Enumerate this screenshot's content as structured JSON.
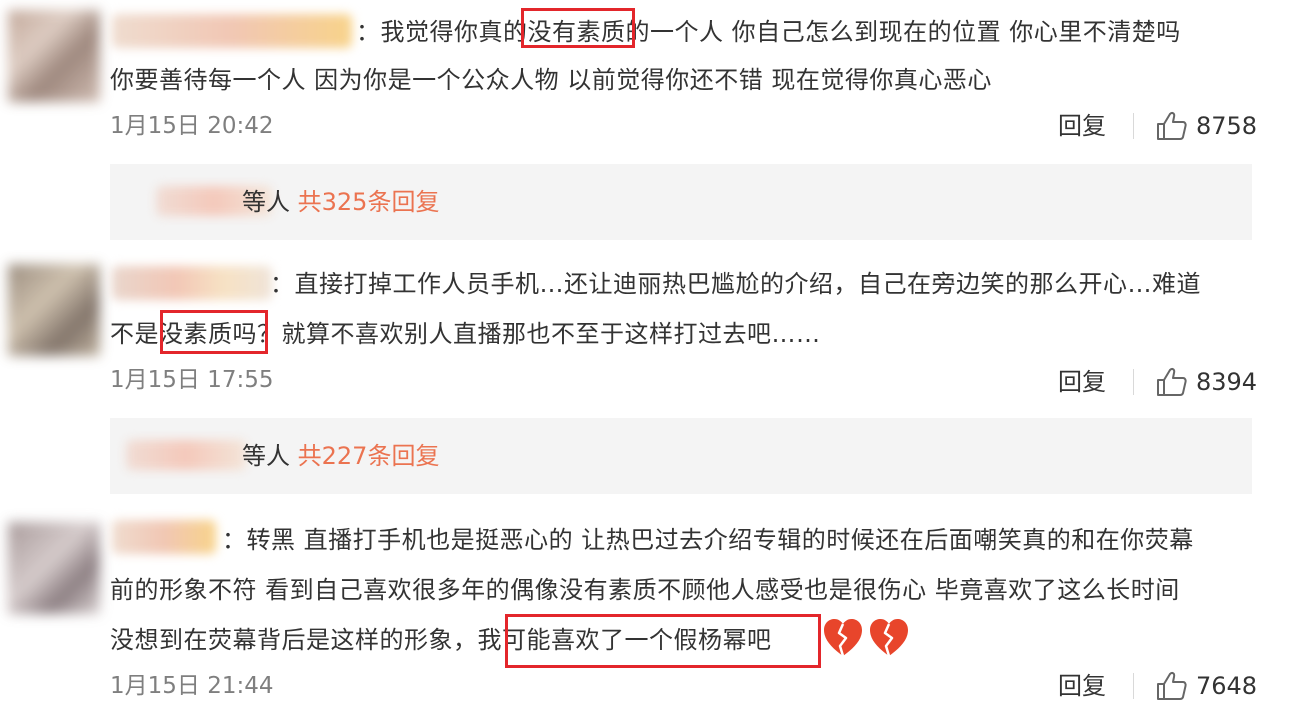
{
  "comments": [
    {
      "lines": [
        "：我觉得你真的没有素质的一个人 你自己怎么到现在的位置 你心里不清楚吗",
        "你要善待每一个人 因为你是一个公众人物 以前觉得你还不错 现在觉得你真心恶心"
      ],
      "time": "1月15日 20:42",
      "reply": "回复",
      "likes": "8758"
    },
    {
      "lines": [
        "：直接打掉工作人员手机…还让迪丽热巴尴尬的介绍，自己在旁边笑的那么开心…难道",
        "不是没素质吗？就算不喜欢别人直播那也不至于这样打过去吧……"
      ],
      "time": "1月15日 17:55",
      "reply": "回复",
      "likes": "8394"
    },
    {
      "lines": [
        "：转黑 直播打手机也是挺恶心的 让热巴过去介绍专辑的时候还在后面嘲笑真的和在你荧幕",
        "前的形象不符 看到自己喜欢很多年的偶像没有素质不顾他人感受也是很伤心 毕竟喜欢了这么长时间",
        "没想到在荧幕背后是这样的形象，我可能喜欢了一个假杨幂吧"
      ],
      "time": "1月15日 21:44",
      "reply": "回复",
      "likes": "7648"
    }
  ],
  "sub_replies": [
    {
      "prefix": "等人",
      "link": "共325条回复"
    },
    {
      "prefix": "等人",
      "link": "共227条回复"
    }
  ],
  "colors": {
    "highlight": "#e3262b",
    "link": "#eb7350",
    "heart": "#e8452b"
  }
}
